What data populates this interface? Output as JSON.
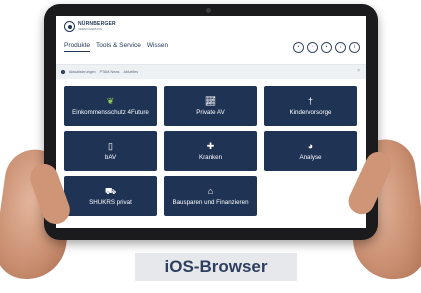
{
  "brand": {
    "name": "NÜRNBERGER",
    "sub": "VERSICHERUNG"
  },
  "nav": [
    "Produkte",
    "Tools & Service",
    "Wissen"
  ],
  "info_items": [
    "Aktualisierungen",
    "PTAM-News",
    "Aktuelles"
  ],
  "tiles": [
    {
      "label": "Einkommensschutz 4Future",
      "icon": "leaf-icon"
    },
    {
      "label": "Private AV",
      "icon": "chart-icon"
    },
    {
      "label": "Kindervorsorge",
      "icon": "child-icon"
    },
    {
      "label": "bAV",
      "icon": "document-icon"
    },
    {
      "label": "Kranken",
      "icon": "medical-bag-icon"
    },
    {
      "label": "Analyse",
      "icon": "pie-chart-icon"
    },
    {
      "label": "SHUKRS privat",
      "icon": "car-icon"
    },
    {
      "label": "Bausparen und Finanzieren",
      "icon": "house-icon"
    }
  ],
  "caption": "iOS-Browser"
}
